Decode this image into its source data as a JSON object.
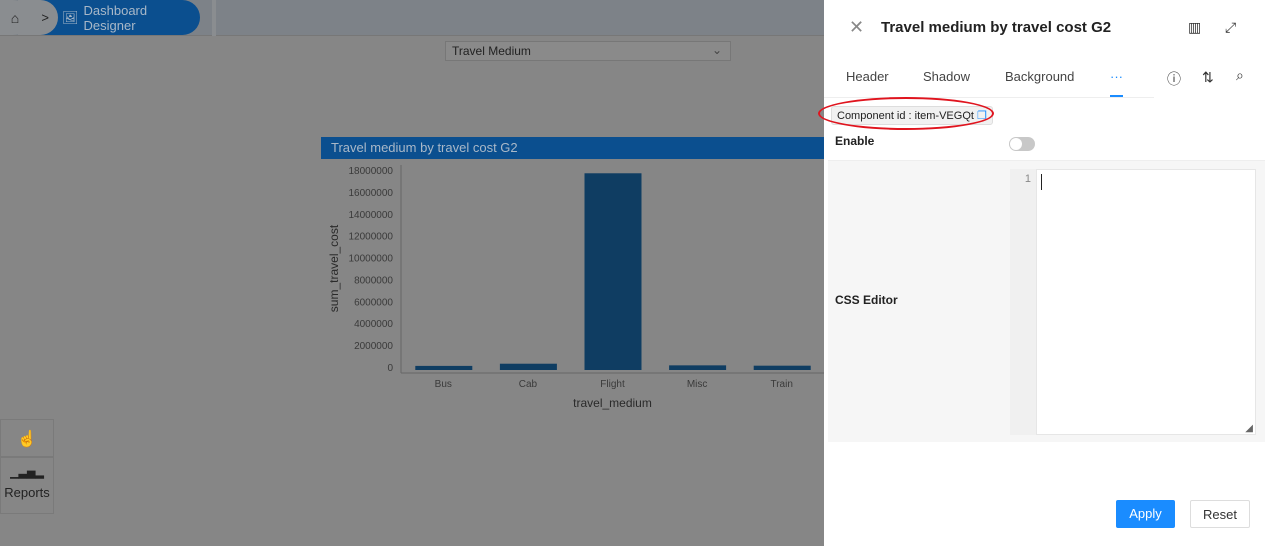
{
  "topbar": {
    "breadcrumb_label": "Dashboard Designer"
  },
  "filter": {
    "selected": "Travel Medium"
  },
  "widget": {
    "title": "Travel medium by travel cost G2"
  },
  "chart_data": {
    "type": "bar",
    "title": "Travel medium by travel cost G2",
    "xlabel": "travel_medium",
    "ylabel": "sum_travel_cost",
    "categories": [
      "Bus",
      "Cab",
      "Flight",
      "Misc",
      "Train"
    ],
    "values": [
      100000,
      300000,
      17700000,
      150000,
      120000
    ],
    "ylim": [
      0,
      18000000
    ],
    "yticks": [
      0,
      2000000,
      4000000,
      6000000,
      8000000,
      10000000,
      12000000,
      14000000,
      16000000,
      18000000
    ],
    "grid": false,
    "color": "#0f3d62"
  },
  "left_tools": {
    "reports_label": "Reports"
  },
  "panel": {
    "title": "Travel medium by travel cost G2",
    "tabs": [
      "Header",
      "Shadow",
      "Background",
      "···"
    ],
    "component_id": "Component id : item-VEGQt",
    "enable_label": "Enable",
    "enable_on": false,
    "css_editor_label": "CSS Editor",
    "line_number": "1",
    "apply_label": "Apply",
    "reset_label": "Reset",
    "accent": "#1a8cff"
  }
}
